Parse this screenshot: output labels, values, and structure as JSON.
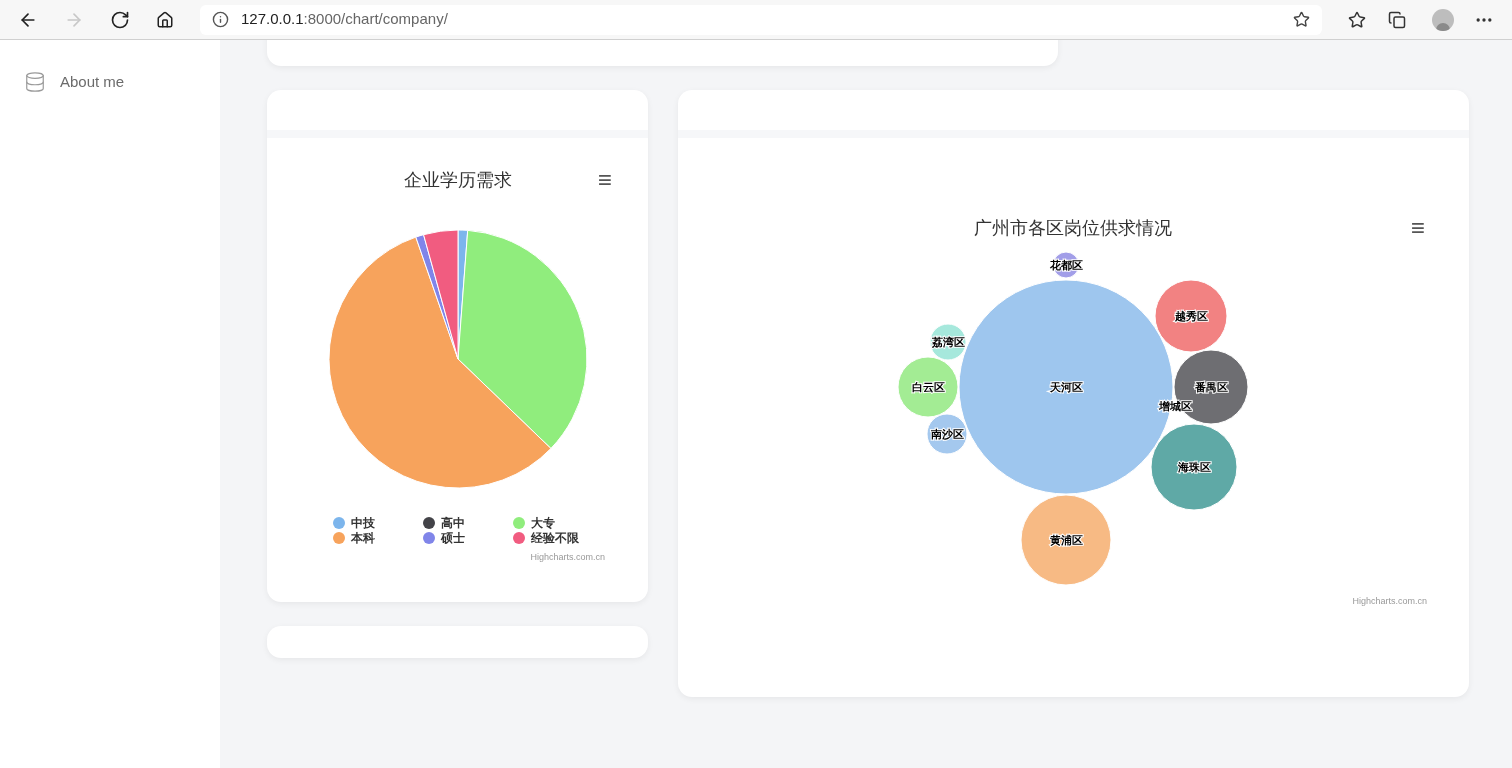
{
  "browser": {
    "url_host": "127.0.0.1",
    "url_path": ":8000/chart/company/",
    "forward_disabled": true
  },
  "sidebar": {
    "items": [
      {
        "label": "About me"
      }
    ]
  },
  "pie_card": {
    "title": "企业学历需求",
    "menu": "≡",
    "legend": [
      {
        "label": "中技",
        "color": "#7cb5ec"
      },
      {
        "label": "高中",
        "color": "#434348"
      },
      {
        "label": "大专",
        "color": "#90ed7d"
      },
      {
        "label": "本科",
        "color": "#f7a35c"
      },
      {
        "label": "硕士",
        "color": "#8085e9"
      },
      {
        "label": "经验不限",
        "color": "#f15c80"
      }
    ],
    "credits": "Highcharts.com.cn"
  },
  "bubble_card": {
    "title": "广州市各区岗位供求情况",
    "menu": "≡",
    "bubbles": [
      {
        "label": "花都区",
        "color": "#a29ee8"
      },
      {
        "label": "天河区",
        "color": "#9ec6ee"
      },
      {
        "label": "越秀区",
        "color": "#f28282"
      },
      {
        "label": "荔湾区",
        "color": "#a6e8dc"
      },
      {
        "label": "白云区",
        "color": "#a3ec94"
      },
      {
        "label": "番禺区",
        "color": "#6e6e72"
      },
      {
        "label": "增城区"
      },
      {
        "label": "南沙区",
        "color": "#a4c8ee"
      },
      {
        "label": "海珠区",
        "color": "#5fa9a6"
      },
      {
        "label": "黄浦区",
        "color": "#f7ba84"
      }
    ],
    "credits": "Highcharts.com.cn"
  }
}
